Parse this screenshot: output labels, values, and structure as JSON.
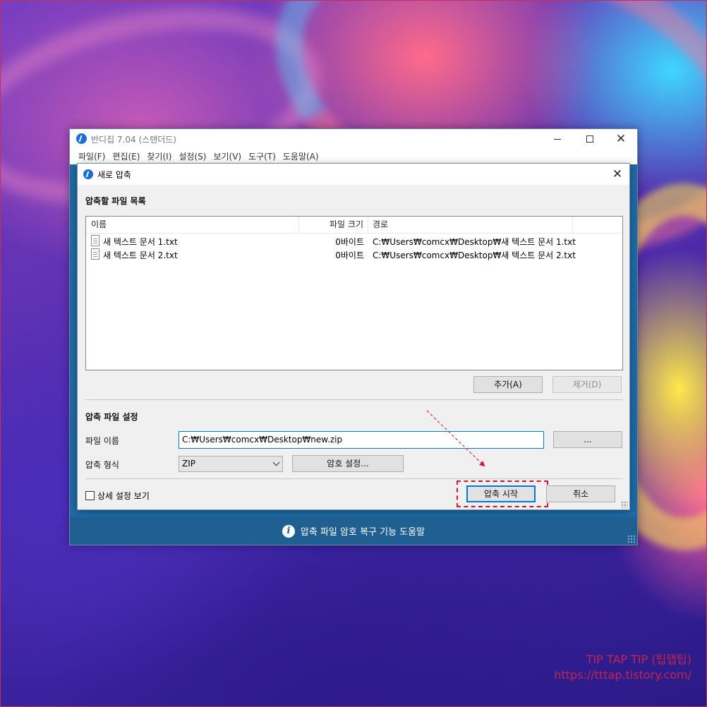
{
  "app": {
    "title": "반디집 7.04 (스탠더드)",
    "menu": [
      "파일(F)",
      "편집(E)",
      "찾기(I)",
      "설정(S)",
      "보기(V)",
      "도구(T)",
      "도움말(A)"
    ],
    "help_bar_text": "압축 파일 암호 복구 기능 도움말"
  },
  "dialog": {
    "title": "새로 압축",
    "file_list_section": "압축할 파일 목록",
    "columns": {
      "name": "이름",
      "size": "파일 크기",
      "path": "경로"
    },
    "files": [
      {
        "name": "새 텍스트 문서 1.txt",
        "size": "0바이트",
        "path": "C:₩Users₩comcx₩Desktop₩새 텍스트 문서 1.txt"
      },
      {
        "name": "새 텍스트 문서 2.txt",
        "size": "0바이트",
        "path": "C:₩Users₩comcx₩Desktop₩새 텍스트 문서 2.txt"
      }
    ],
    "add_button": "추가(A)",
    "remove_button": "제거(D)",
    "settings_section": "압축 파일 설정",
    "filename_label": "파일 이름",
    "filename_value": "C:₩Users₩comcx₩Desktop₩new.zip",
    "browse_button": "...",
    "format_label": "압축 형식",
    "format_value": "ZIP",
    "password_button": "암호 설정...",
    "advanced_checkbox": "상세 설정 보기",
    "start_button": "압축 시작",
    "cancel_button": "취소"
  },
  "watermark": {
    "line1": "TIP TAP TIP (팁탭팁)",
    "line2": "https://tttap.tistory.com/"
  },
  "colors": {
    "highlight": "#e0102a",
    "accent": "#0078d7",
    "help_bar": "#1f5f92"
  }
}
